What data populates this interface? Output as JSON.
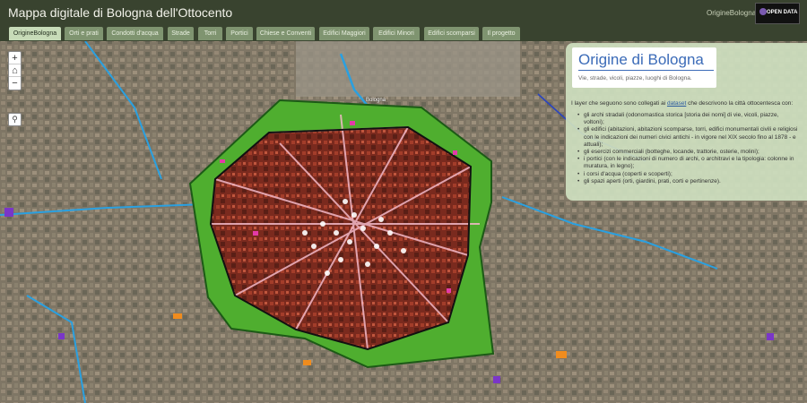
{
  "header": {
    "title": "Mappa digitale di Bologna dell'Ottocento",
    "link": "OrigineBologna",
    "logo_text": "OPEN DATA"
  },
  "tabs": [
    {
      "label": "OrigineBologna",
      "active": true
    },
    {
      "label": "Orti e prati",
      "active": false
    },
    {
      "label": "Condotti d'acqua",
      "active": false
    },
    {
      "label": "Strade",
      "active": false
    },
    {
      "label": "Torri",
      "active": false
    },
    {
      "label": "Portici",
      "active": false
    },
    {
      "label": "Chiese e Conventi",
      "active": false
    },
    {
      "label": "Edifici Maggiori",
      "active": false
    },
    {
      "label": "Edifici Minori",
      "active": false
    },
    {
      "label": "Edifici scomparsi",
      "active": false
    },
    {
      "label": "Il progetto",
      "active": false
    }
  ],
  "map": {
    "zoom_in": "+",
    "home": "⌂",
    "zoom_out": "−",
    "search": "⚲",
    "labels": [
      "Bologna"
    ]
  },
  "panel": {
    "title": "Origine di Bologna",
    "subtitle": "Vie, strade, vicoli, piazze, luoghi di Bologna.",
    "intro_pre": "I layer che seguono sono collegati ai ",
    "intro_link": "dataset",
    "intro_post": " che descrivono la città ottocentesca con:",
    "items": [
      "gli archi stradali (odonomastica storica [storia dei nomi] di vie, vicoli, piazze, voltoni);",
      "gli edifici (abitazioni, abitazioni scomparse, torri, edifici monumentali civili e religiosi con le indicazioni dei numeri civici antichi - in vigore nel XIX secolo fino al 1878 - e attuali);",
      "gli esercizi commerciali (botteghe, locande, trattorie, osterie, molini);",
      "i portici (con le indicazioni di numero di archi, o architravi e la tipologia: colonne in muratura, in legno);",
      "i corsi d'acqua (coperti e scoperti);",
      "gli spazi aperti (orti, giardini, prati, corti e pertinenze)."
    ]
  },
  "colors": {
    "header_bg": "#39432f",
    "tab_bg": "#7f9470",
    "tab_active_bg": "#c7dbb8",
    "green_area": "#4fae2f",
    "water": "#3aa8d8",
    "panel_title": "#3b6bb8"
  }
}
